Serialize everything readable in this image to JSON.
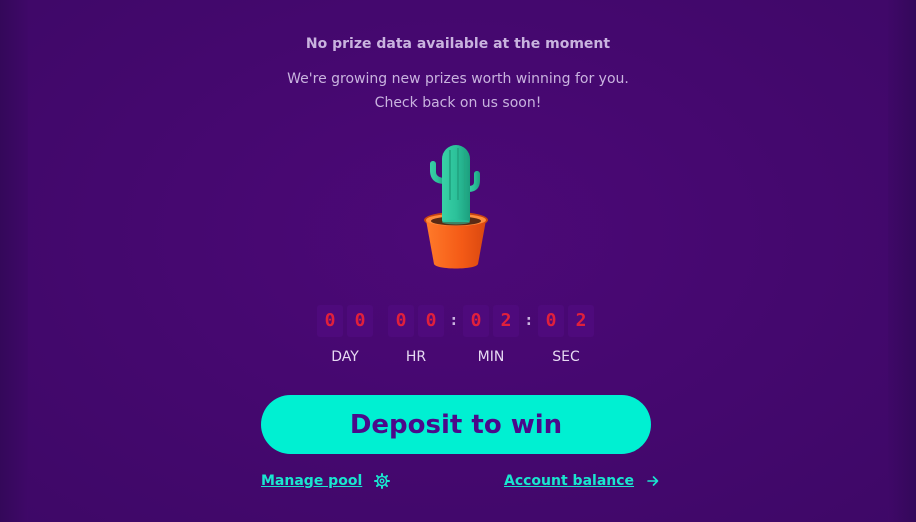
{
  "empty_state": {
    "title": "No prize data available at the moment",
    "message_line1": "We're growing new prizes worth winning for you.",
    "message_line2": "Check back on us soon!",
    "illustration": "cactus-in-pot"
  },
  "countdown": {
    "days": [
      "0",
      "0"
    ],
    "hours": [
      "0",
      "0"
    ],
    "minutes": [
      "0",
      "2"
    ],
    "seconds": [
      "0",
      "2"
    ],
    "separator": ":",
    "labels": {
      "days": "DAY",
      "hours": "HR",
      "minutes": "MIN",
      "seconds": "SEC"
    }
  },
  "actions": {
    "deposit_label": "Deposit to win",
    "manage_pool_label": "Manage pool",
    "manage_pool_icon": "gear-icon",
    "account_balance_label": "Account balance",
    "account_balance_icon": "arrow-right-icon"
  },
  "colors": {
    "background": "#45086f",
    "accent": "#00f0d2",
    "digit_text": "#e0203c",
    "button_text": "#4b0a8a"
  }
}
